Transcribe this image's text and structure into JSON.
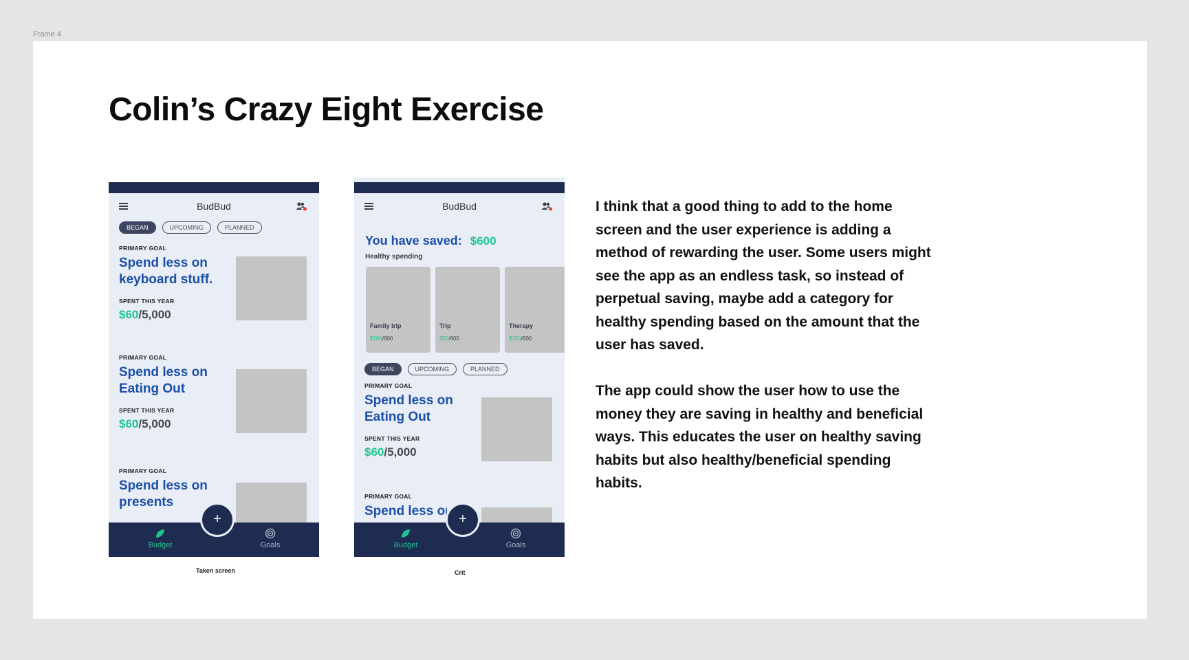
{
  "frame_label": "Frame 4",
  "title": "Colin’s Crazy Eight Exercise",
  "phone1": {
    "app_title": "BudBud",
    "chips": [
      "BEGAN",
      "UPCOMING",
      "PLANNED"
    ],
    "goals": [
      {
        "label": "PRIMARY GOAL",
        "title": "Spend less on keyboard stuff.",
        "spent_label": "SPENT THIS YEAR",
        "spent": "$60",
        "total": "/5,000"
      },
      {
        "label": "PRIMARY GOAL",
        "title": "Spend less on Eating Out",
        "spent_label": "SPENT THIS YEAR",
        "spent": "$60",
        "total": "/5,000"
      },
      {
        "label": "PRIMARY GOAL",
        "title": "Spend less on presents"
      }
    ],
    "nav": {
      "budget": "Budget",
      "goals": "Goals",
      "fab": "+"
    },
    "caption": "Taken screen"
  },
  "phone2": {
    "app_title": "BudBud",
    "saved_label": "You have saved:",
    "saved_amount": "$600",
    "healthy_label": "Healthy spending",
    "cards": [
      {
        "name": "Family trip",
        "spent": "$100",
        "total": "/600"
      },
      {
        "name": "Trip",
        "spent": "$50",
        "total": "/600"
      },
      {
        "name": "Therapy",
        "spent": "$150",
        "total": "/600"
      }
    ],
    "chips": [
      "BEGAN",
      "UPCOMING",
      "PLANNED"
    ],
    "goals": [
      {
        "label": "PRIMARY GOAL",
        "title": "Spend less on Eating Out",
        "spent_label": "SPENT THIS YEAR",
        "spent": "$60",
        "total": "/5,000"
      },
      {
        "label": "PRIMARY GOAL",
        "title": "Spend less on"
      }
    ],
    "nav": {
      "budget": "Budget",
      "goals": "Goals",
      "fab": "+"
    },
    "caption": "Crit"
  },
  "paragraphs": [
    "I think that a good thing to add to the home screen and the user experience is adding a method of rewarding the user. Some users might see the app as an endless task, so instead of perpetual saving, maybe add a category for healthy spending based on the amount that the user has saved.",
    "The app could show the user how to use the money they are saving in healthy and beneficial ways. This educates the user on healthy saving habits but also healthy/beneficial spending habits."
  ],
  "colors": {
    "navy": "#1f2c52",
    "accent_green": "#1fc48f",
    "goal_blue": "#1b4fa8",
    "phone_bg": "#e9edf5"
  }
}
